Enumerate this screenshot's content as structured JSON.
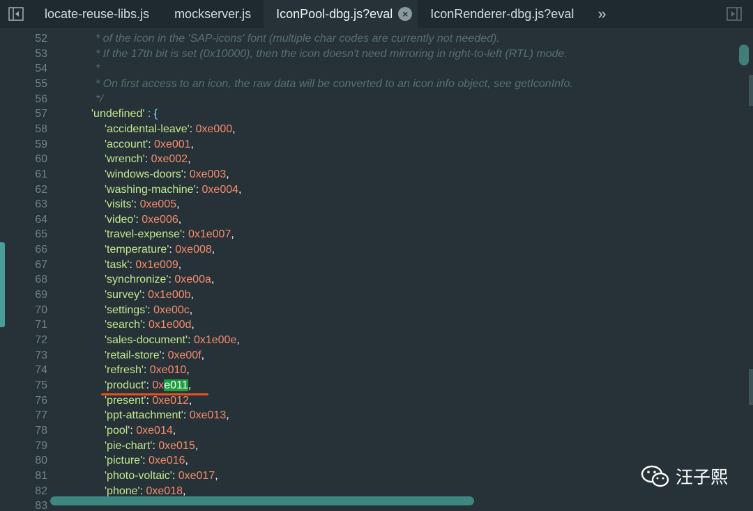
{
  "tabs": [
    {
      "label": "locate-reuse-libs.js",
      "active": false
    },
    {
      "label": "mockserver.js",
      "active": false
    },
    {
      "label": "IconPool-dbg.js?eval",
      "active": true
    },
    {
      "label": "IconRenderer-dbg.js?eval",
      "active": false
    }
  ],
  "tab_close_label": "×",
  "tab_overflow_label": "»",
  "watermark_text": "汪子熙",
  "colors": {
    "background": "#263238",
    "comment": "#586e75",
    "string": "#c3e88d",
    "number": "#f78c6c",
    "highlight": "#1f9e3e",
    "annotation_underline": "#e8511f"
  },
  "lines": [
    {
      "n": "52",
      "t": "comment",
      "text": "* of the icon in the 'SAP-icons' font (multiple char codes are currently not needed)."
    },
    {
      "n": "53",
      "t": "comment",
      "text": "* If the 17th bit is set (0x10000), then the icon doesn't need mirroring in right-to-left (RTL) mode."
    },
    {
      "n": "54",
      "t": "comment",
      "text": "*"
    },
    {
      "n": "55",
      "t": "comment",
      "text": "* On first access to an icon, the raw data will be converted to an icon info object, see getIconInfo."
    },
    {
      "n": "56",
      "t": "comment",
      "text": "*/"
    },
    {
      "n": "57",
      "t": "open",
      "key": "'undefined'",
      "text": "{"
    },
    {
      "n": "58",
      "t": "entry",
      "key": "'accidental-leave'",
      "val": "0xe000"
    },
    {
      "n": "59",
      "t": "entry",
      "key": "'account'",
      "val": "0xe001"
    },
    {
      "n": "60",
      "t": "entry",
      "key": "'wrench'",
      "val": "0xe002"
    },
    {
      "n": "61",
      "t": "entry",
      "key": "'windows-doors'",
      "val": "0xe003"
    },
    {
      "n": "62",
      "t": "entry",
      "key": "'washing-machine'",
      "val": "0xe004"
    },
    {
      "n": "63",
      "t": "entry",
      "key": "'visits'",
      "val": "0xe005"
    },
    {
      "n": "64",
      "t": "entry",
      "key": "'video'",
      "val": "0xe006"
    },
    {
      "n": "65",
      "t": "entry",
      "key": "'travel-expense'",
      "val": "0x1e007"
    },
    {
      "n": "66",
      "t": "entry",
      "key": "'temperature'",
      "val": "0xe008"
    },
    {
      "n": "67",
      "t": "entry",
      "key": "'task'",
      "val": "0x1e009"
    },
    {
      "n": "68",
      "t": "entry",
      "key": "'synchronize'",
      "val": "0xe00a"
    },
    {
      "n": "69",
      "t": "entry",
      "key": "'survey'",
      "val": "0x1e00b"
    },
    {
      "n": "70",
      "t": "entry",
      "key": "'settings'",
      "val": "0xe00c"
    },
    {
      "n": "71",
      "t": "entry",
      "key": "'search'",
      "val": "0x1e00d"
    },
    {
      "n": "72",
      "t": "entry",
      "key": "'sales-document'",
      "val": "0x1e00e"
    },
    {
      "n": "73",
      "t": "entry",
      "key": "'retail-store'",
      "val": "0xe00f"
    },
    {
      "n": "74",
      "t": "entry",
      "key": "'refresh'",
      "val": "0xe010"
    },
    {
      "n": "75",
      "t": "entry",
      "key": "'product'",
      "val": "0x",
      "val_hl": "e011"
    },
    {
      "n": "76",
      "t": "entry",
      "key": "'present'",
      "val": "0xe012"
    },
    {
      "n": "77",
      "t": "entry",
      "key": "'ppt-attachment'",
      "val": "0xe013"
    },
    {
      "n": "78",
      "t": "entry",
      "key": "'pool'",
      "val": "0xe014"
    },
    {
      "n": "79",
      "t": "entry",
      "key": "'pie-chart'",
      "val": "0xe015"
    },
    {
      "n": "80",
      "t": "entry",
      "key": "'picture'",
      "val": "0xe016"
    },
    {
      "n": "81",
      "t": "entry",
      "key": "'photo-voltaic'",
      "val": "0xe017"
    },
    {
      "n": "82",
      "t": "entry",
      "key": "'phone'",
      "val": "0xe018"
    },
    {
      "n": "83",
      "t": "blank"
    }
  ]
}
